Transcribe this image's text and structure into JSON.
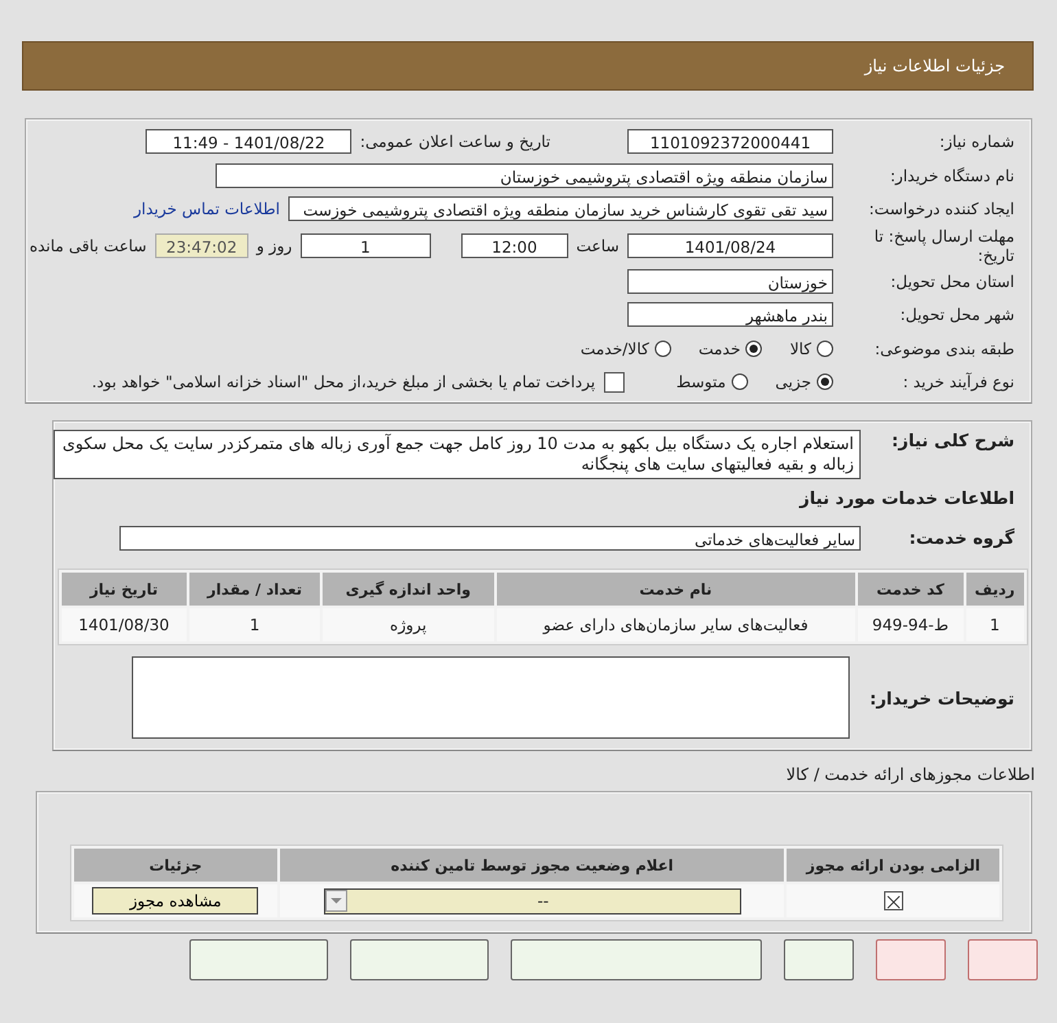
{
  "header": {
    "title": "جزئیات اطلاعات نیاز"
  },
  "need_number": {
    "label": "شماره نیاز:",
    "value": "1101092372000441"
  },
  "announce": {
    "label": "تاریخ و ساعت اعلان عمومی:",
    "value": "1401/08/22 - 11:49"
  },
  "buyer_org": {
    "label": "نام دستگاه خریدار:",
    "value": "سازمان منطقه ویژه اقتصادی پتروشیمی خوزستان"
  },
  "requester": {
    "label": "ایجاد کننده درخواست:",
    "value": "سید تقی تقوی کارشناس خرید سازمان منطقه ویژه اقتصادی پتروشیمی خوزست",
    "link": "اطلاعات تماس خریدار"
  },
  "deadline": {
    "label": "مهلت ارسال پاسخ: تا تاریخ:",
    "date": "1401/08/24",
    "time_label": "ساعت",
    "time": "12:00",
    "days": "1",
    "days_label": "روز و",
    "remaining": "23:47:02",
    "remaining_label": "ساعت باقی مانده"
  },
  "province": {
    "label": "استان محل تحویل:",
    "value": "خوزستان"
  },
  "city": {
    "label": "شهر محل تحویل:",
    "value": "بندر ماهشهر"
  },
  "category": {
    "label": "طبقه بندی موضوعی:",
    "options": [
      {
        "label": "کالا",
        "selected": false
      },
      {
        "label": "خدمت",
        "selected": true
      },
      {
        "label": "کالا/خدمت",
        "selected": false
      }
    ]
  },
  "purchase_type": {
    "label": "نوع فرآیند خرید :",
    "options": [
      {
        "label": "جزیی",
        "selected": true
      },
      {
        "label": "متوسط",
        "selected": false
      }
    ],
    "payment": {
      "checked": false,
      "text": "پرداخت تمام یا بخشی از مبلغ خرید،از محل \"اسناد خزانه اسلامی\" خواهد بود."
    }
  },
  "description": {
    "label": "شرح کلی نیاز:",
    "value": "استعلام اجاره یک دستگاه بیل بکهو به مدت 10 روز کامل جهت جمع آوری زباله های متمرکزدر سایت یک محل سکوی زباله و بقیه فعالیتهای سایت های پنجگانه"
  },
  "services_title": "اطلاعات خدمات مورد نیاز",
  "service_group": {
    "label": "گروه خدمت:",
    "value": "سایر فعالیت‌های خدماتی"
  },
  "table": {
    "columns": [
      "ردیف",
      "کد خدمت",
      "نام خدمت",
      "واحد اندازه گیری",
      "تعداد / مقدار",
      "تاریخ نیاز"
    ],
    "rows": [
      [
        "1",
        "ط-94-949",
        "فعالیت‌های سایر سازمان‌های دارای عضو",
        "پروژه",
        "1",
        "1401/08/30"
      ]
    ]
  },
  "buyer_notes": {
    "label": "توضیحات خریدار:"
  },
  "permits_title": "اطلاعات مجوزهای ارائه خدمت / کالا",
  "permits": {
    "columns": [
      "الزامی بودن ارائه مجوز",
      "اعلام وضعیت مجوز توسط تامین کننده",
      "جزئیات"
    ],
    "rows": [
      {
        "required": true,
        "status": "--",
        "button": "مشاهده مجوز"
      }
    ]
  },
  "bottom_buttons": [
    {
      "kind": "action"
    },
    {
      "kind": "action"
    },
    {
      "kind": "action"
    },
    {
      "kind": "action"
    },
    {
      "kind": "cancel"
    },
    {
      "kind": "cancel"
    }
  ]
}
